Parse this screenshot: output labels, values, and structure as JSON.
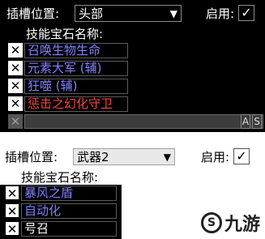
{
  "panel1": {
    "slot_label": "插槽位置:",
    "slot_value": "头部",
    "enable_label": "启用:",
    "enable_check": "✓",
    "gems_header": "技能宝石名称:",
    "gems": [
      {
        "remove": "✕",
        "name": "召唤生物生命",
        "color": "blue"
      },
      {
        "remove": "✕",
        "name": "元素大军 (辅)",
        "color": "blue"
      },
      {
        "remove": "✕",
        "name": "狂噬 (辅)",
        "color": "blue"
      },
      {
        "remove": "✕",
        "name": "惩击之幻化守卫",
        "color": "red"
      }
    ],
    "empty_remove": "✕",
    "btn_a": "A",
    "btn_s": "S"
  },
  "panel2": {
    "slot_label": "插槽位置:",
    "slot_value": "武器2",
    "enable_label": "启用:",
    "enable_check": "✓",
    "gems_header": "技能宝石名称:",
    "gems": [
      {
        "remove": "✕",
        "name": "暴风之盾",
        "color": "blue"
      },
      {
        "remove": "✕",
        "name": "自动化",
        "color": "blue"
      },
      {
        "remove": "✕",
        "name": "号召",
        "color": "white"
      }
    ]
  },
  "watermark": {
    "text": "九游"
  },
  "colors": {
    "gem_blue": "#8080ff",
    "gem_red": "#ff4040",
    "background": "#000000"
  }
}
